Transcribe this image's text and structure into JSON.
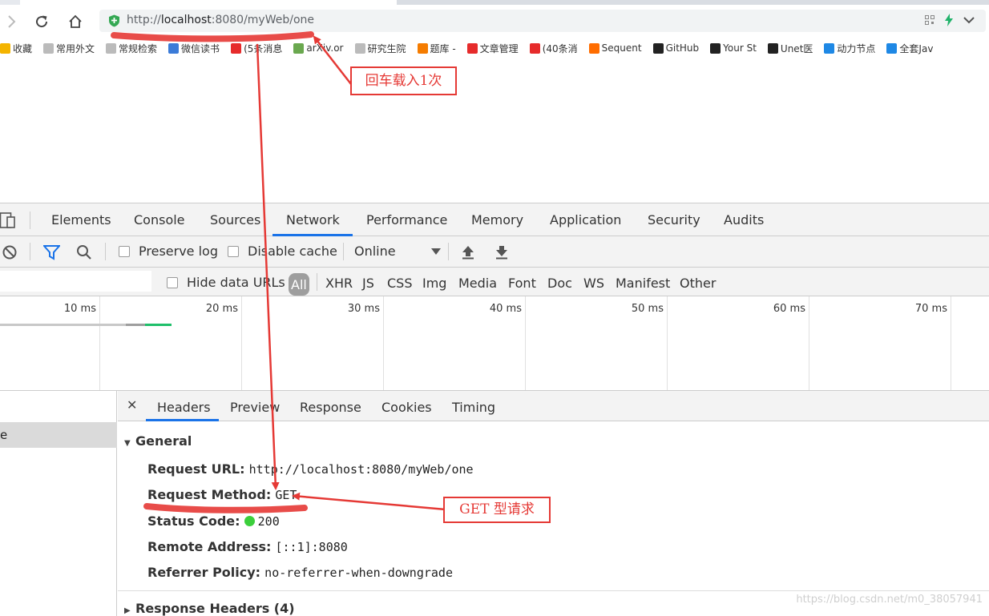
{
  "browser": {
    "url_scheme": "http://",
    "url_host": "localhost",
    "url_rest": ":8080/myWeb/one"
  },
  "bookmarks": [
    {
      "label": "收藏",
      "icon": "star-icon",
      "color": "#f4b400"
    },
    {
      "label": "常用外文",
      "icon": "page-icon",
      "color": "#bbbbbb"
    },
    {
      "label": "常规检索",
      "icon": "page-icon",
      "color": "#bbbbbb"
    },
    {
      "label": "微信读书",
      "icon": "wechat-read-icon",
      "color": "#3b7bd8"
    },
    {
      "label": "(5条消息",
      "icon": "csdn-icon",
      "color": "#e62b2b"
    },
    {
      "label": "arXiv.or",
      "icon": "arxiv-icon",
      "color": "#6aa84f"
    },
    {
      "label": "研究生院",
      "icon": "page-icon",
      "color": "#bbbbbb"
    },
    {
      "label": "题库 -",
      "icon": "tiku-icon",
      "color": "#f57c00"
    },
    {
      "label": "文章管理",
      "icon": "csdn-icon",
      "color": "#e62b2b"
    },
    {
      "label": "(40条消",
      "icon": "csdn-icon",
      "color": "#e62b2b"
    },
    {
      "label": "Sequent",
      "icon": "flame-icon",
      "color": "#ff6d00"
    },
    {
      "label": "GitHub",
      "icon": "github-icon",
      "color": "#222222"
    },
    {
      "label": "Your St",
      "icon": "github-icon",
      "color": "#222222"
    },
    {
      "label": "Unet医",
      "icon": "github-icon",
      "color": "#222222"
    },
    {
      "label": "动力节点",
      "icon": "bilibili-icon",
      "color": "#1e88e5"
    },
    {
      "label": "全套Jav",
      "icon": "baidu-icon",
      "color": "#1e88e5"
    }
  ],
  "devtools": {
    "tabs": [
      "Elements",
      "Console",
      "Sources",
      "Network",
      "Performance",
      "Memory",
      "Application",
      "Security",
      "Audits"
    ],
    "active_tab": "Network",
    "toolbar": {
      "preserve_log": "Preserve log",
      "disable_cache": "Disable cache",
      "throttle": "Online"
    },
    "filter": {
      "hide_data_urls": "Hide data URLs",
      "types": [
        "All",
        "XHR",
        "JS",
        "CSS",
        "Img",
        "Media",
        "Font",
        "Doc",
        "WS",
        "Manifest",
        "Other"
      ]
    },
    "timeline_ticks": [
      "10 ms",
      "20 ms",
      "30 ms",
      "40 ms",
      "50 ms",
      "60 ms",
      "70 ms"
    ],
    "request_row": "e",
    "detail_tabs": [
      "Headers",
      "Preview",
      "Response",
      "Cookies",
      "Timing"
    ],
    "general": {
      "title": "General",
      "request_url_key": "Request URL:",
      "request_url": "http://localhost:8080/myWeb/one",
      "request_method_key": "Request Method:",
      "request_method": "GET",
      "status_code_key": "Status Code:",
      "status_code": "200",
      "remote_address_key": "Remote Address:",
      "remote_address": "[::1]:8080",
      "referrer_policy_key": "Referrer Policy:",
      "referrer_policy": "no-referrer-when-downgrade"
    },
    "response_headers_title": "Response Headers (4)"
  },
  "annotations": {
    "reload_note": "回车载入1次",
    "get_note": "GET 型请求",
    "color": "#e53935"
  },
  "watermark": "https://blog.csdn.net/m0_38057941"
}
